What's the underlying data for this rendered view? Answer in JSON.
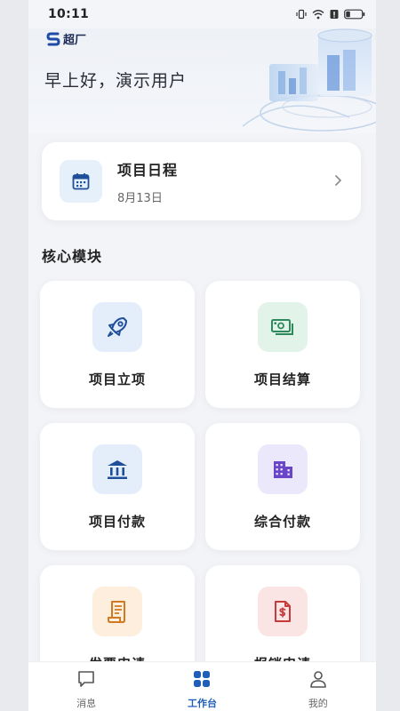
{
  "status_bar": {
    "time": "10:11"
  },
  "header": {
    "brand_name": "超厂",
    "greeting": "早上好，演示用户"
  },
  "schedule": {
    "title": "项目日程",
    "date": "8月13日"
  },
  "section": {
    "title": "核心模块"
  },
  "modules": [
    {
      "label": "项目立项",
      "icon": "rocket-icon",
      "icon_bg": "#e4eefb",
      "icon_color": "#1f4f9a"
    },
    {
      "label": "项目结算",
      "icon": "banknote-icon",
      "icon_bg": "#e2f3ea",
      "icon_color": "#2e8a5a"
    },
    {
      "label": "项目付款",
      "icon": "bank-icon",
      "icon_bg": "#e4eefb",
      "icon_color": "#1f4f9a"
    },
    {
      "label": "综合付款",
      "icon": "building-icon",
      "icon_bg": "#ece8fb",
      "icon_color": "#6a45c8"
    },
    {
      "label": "发票申请",
      "icon": "receipt-icon",
      "icon_bg": "#fdeedd",
      "icon_color": "#d27a22"
    },
    {
      "label": "报销申请",
      "icon": "dollar-document-icon",
      "icon_bg": "#fbe4e4",
      "icon_color": "#c83a3a"
    }
  ],
  "nav": {
    "items": [
      {
        "label": "消息",
        "icon": "message-icon"
      },
      {
        "label": "工作台",
        "icon": "grid-icon",
        "active": true
      },
      {
        "label": "我的",
        "icon": "user-icon"
      }
    ]
  }
}
